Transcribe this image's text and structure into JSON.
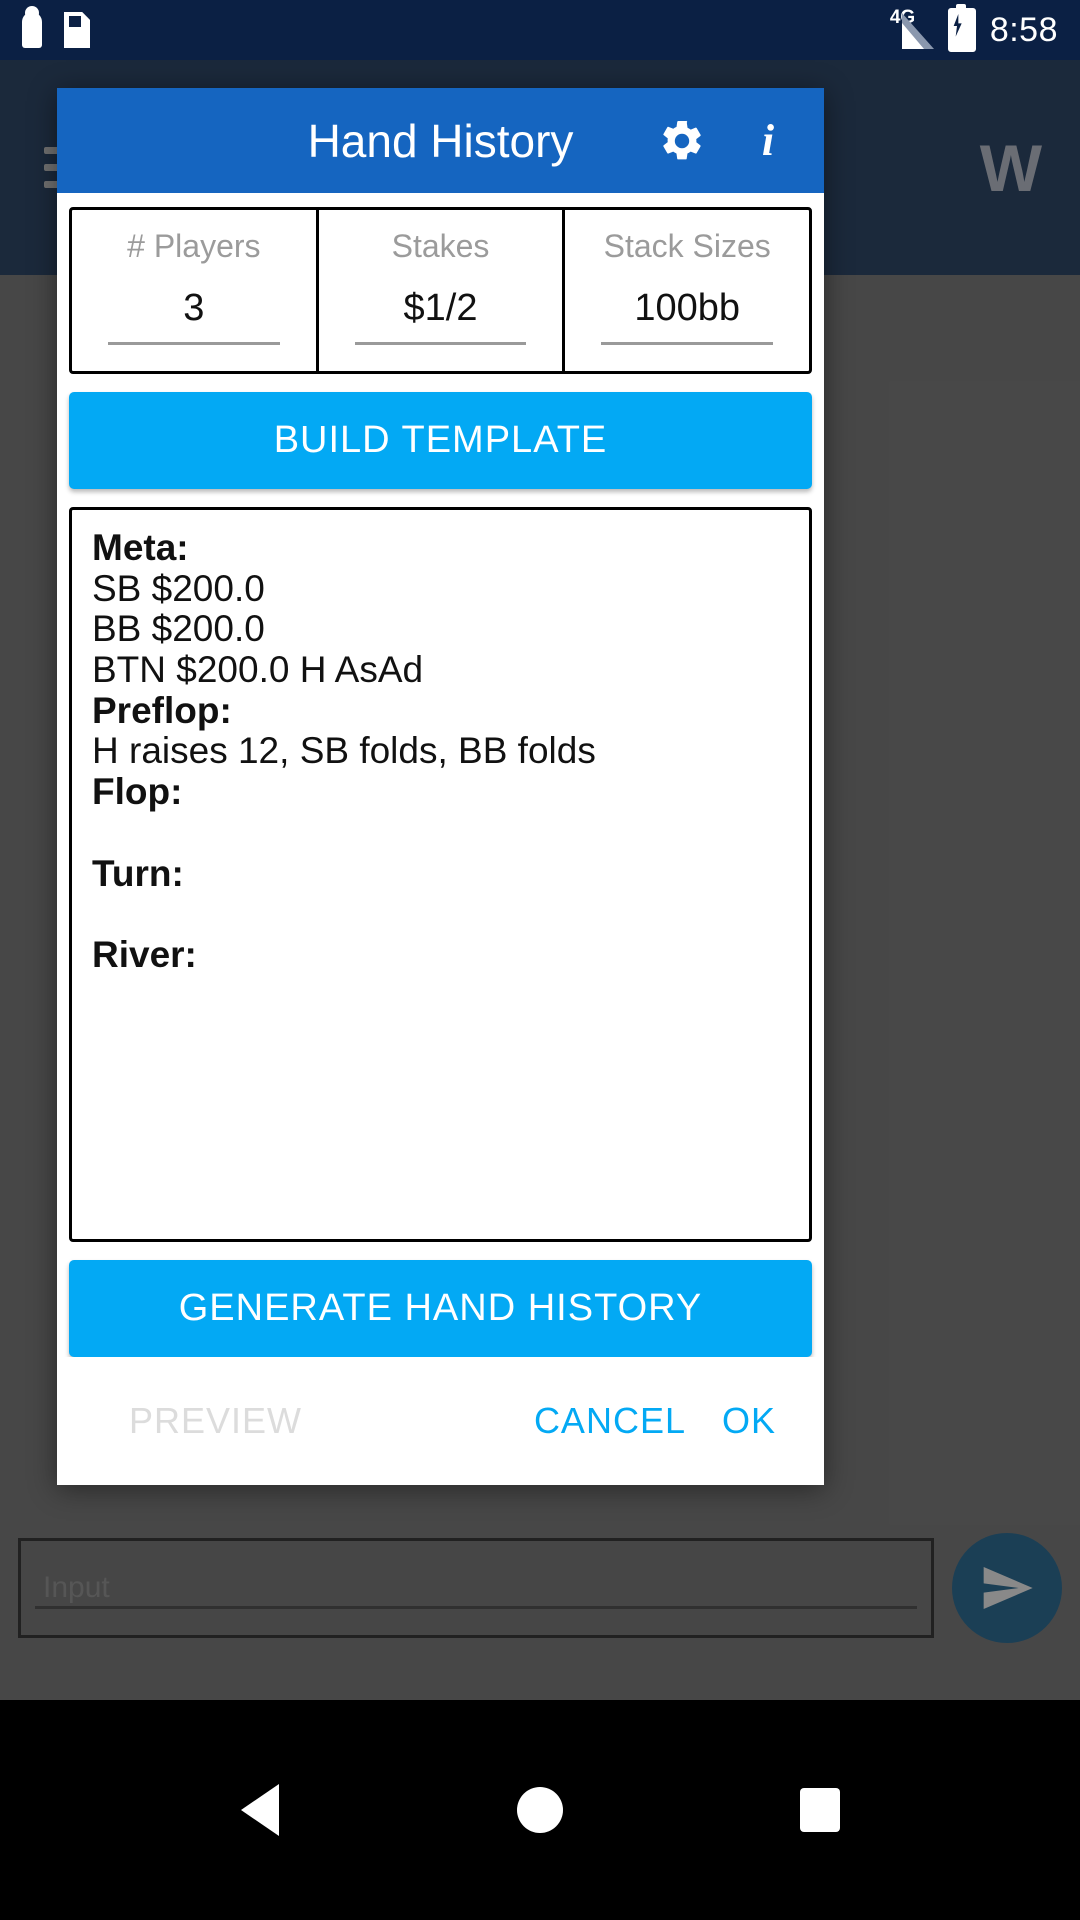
{
  "status_bar": {
    "time": "8:58",
    "network_label": "4G",
    "icons": [
      "usb-icon",
      "sd-card-icon",
      "signal-icon",
      "battery-charging-icon"
    ]
  },
  "background_app": {
    "menu_icon": "hamburger-menu-icon",
    "logo_text": "W",
    "input_placeholder": "Input",
    "send_icon": "send-icon"
  },
  "dialog": {
    "title": "Hand History",
    "settings_icon": "gear-icon",
    "info_icon": "info-icon",
    "fields": [
      {
        "label": "# Players",
        "value": "3",
        "name": "num-players"
      },
      {
        "label": "Stakes",
        "value": "$1/2",
        "name": "stakes"
      },
      {
        "label": "Stack Sizes",
        "value": "100bb",
        "name": "stack-sizes"
      }
    ],
    "build_template_label": "BUILD TEMPLATE",
    "generate_label": "GENERATE HAND HISTORY",
    "hand_history": [
      {
        "text": "Meta:",
        "bold": true
      },
      {
        "text": "SB $200.0",
        "bold": false
      },
      {
        "text": "BB $200.0",
        "bold": false
      },
      {
        "text": "BTN $200.0 H AsAd",
        "bold": false
      },
      {
        "text": "Preflop:",
        "bold": true
      },
      {
        "text": "H raises 12, SB folds, BB folds",
        "bold": false
      },
      {
        "text": "Flop:",
        "bold": true
      },
      {
        "text": " ",
        "bold": false
      },
      {
        "text": "Turn:",
        "bold": true
      },
      {
        "text": " ",
        "bold": false
      },
      {
        "text": "River:",
        "bold": true
      }
    ],
    "actions": {
      "preview_label": "PREVIEW",
      "cancel_label": "CANCEL",
      "ok_label": "OK"
    }
  },
  "nav_bar": {
    "back": "back-icon",
    "home": "home-icon",
    "recents": "recents-icon"
  },
  "colors": {
    "status_bar_bg": "#0b2044",
    "app_bar_bg": "#0d2a52",
    "dialog_header_bg": "#1565c0",
    "accent_blue": "#03a9f4",
    "scrim": "rgba(40,40,40,0.55)"
  }
}
